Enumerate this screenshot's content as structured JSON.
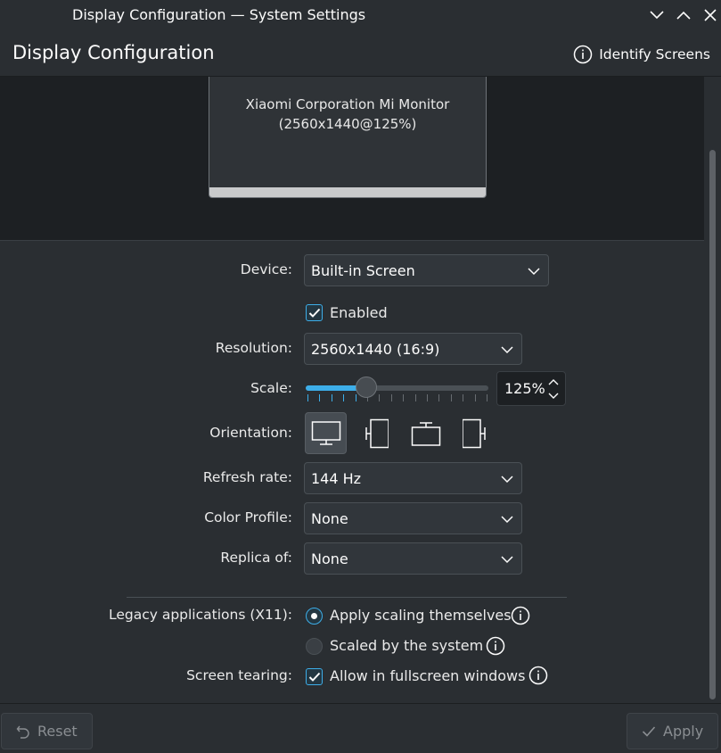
{
  "window": {
    "title": "Display Configuration — System Settings"
  },
  "header": {
    "page_title": "Display Configuration",
    "identify_label": "Identify Screens"
  },
  "monitor": {
    "name": "Xiaomi Corporation Mi Monitor",
    "mode": "(2560x1440@125%)"
  },
  "form": {
    "device_label": "Device:",
    "device_value": "Built-in Screen",
    "enabled_label": "Enabled",
    "resolution_label": "Resolution:",
    "resolution_value": "2560x1440 (16:9)",
    "scale_label": "Scale:",
    "scale_value": "125%",
    "scale_fraction": 0.33,
    "orientation_label": "Orientation:",
    "refresh_label": "Refresh rate:",
    "refresh_value": "144 Hz",
    "color_profile_label": "Color Profile:",
    "color_profile_value": "None",
    "replica_label": "Replica of:",
    "replica_value": "None",
    "legacy_label": "Legacy applications (X11):",
    "legacy_opt1": "Apply scaling themselves",
    "legacy_opt2": "Scaled by the system",
    "tearing_label": "Screen tearing:",
    "tearing_opt": "Allow in fullscreen windows"
  },
  "footer": {
    "reset_label": "Reset",
    "apply_label": "Apply"
  },
  "colors": {
    "accent": "#3daee9",
    "background": "#2a2e32",
    "text": "#fcfcfc"
  }
}
